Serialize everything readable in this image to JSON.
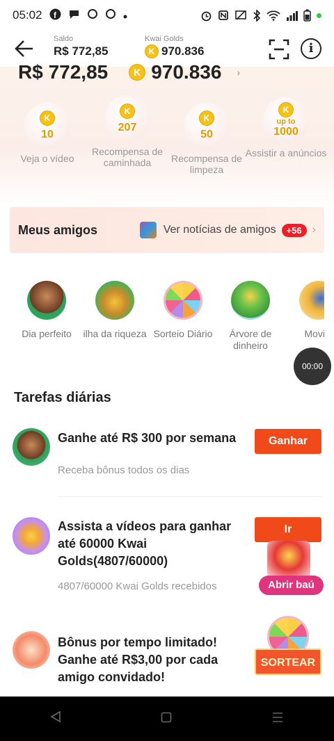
{
  "status": {
    "time": "05:02",
    "icons": [
      "facebook-icon",
      "chat-icon",
      "app-icon",
      "app-icon",
      "dot-icon"
    ],
    "right_icons": [
      "alarm-icon",
      "nfc-icon",
      "cast-icon",
      "bluetooth-icon",
      "wifi-icon",
      "signal-icon",
      "battery-icon"
    ]
  },
  "header": {
    "saldo_label": "Saldo",
    "saldo_value": "R$ 772,85",
    "golds_label": "Kwai Golds",
    "golds_value": "970.836"
  },
  "balance": {
    "money": "R$ 772,85",
    "golds": "970.836",
    "coin_letter": "K",
    "chevron": "›"
  },
  "rewards": [
    {
      "value": "10",
      "label": "Veja o vídeo"
    },
    {
      "value": "207",
      "label": "Recompensa de caminhada"
    },
    {
      "value": "50",
      "label": "Recompensa de limpeza"
    },
    {
      "prefix": "up to",
      "value": "1000",
      "label": "Assistir a anúncios"
    }
  ],
  "friends": {
    "title": "Meus amigos",
    "news": "Ver notícias de amigos",
    "badge": "+56"
  },
  "games": [
    {
      "label": "Dia perfeito"
    },
    {
      "label": "ilha da riqueza"
    },
    {
      "label": "Sorteio Diário"
    },
    {
      "label": "Árvore de dinheiro"
    },
    {
      "label": "Movim"
    }
  ],
  "timer": "00:00",
  "tasks": {
    "title": "Tarefas diárias",
    "items": [
      {
        "title": "Ganhe até R$ 300 por semana",
        "subtitle": "Receba bônus todos os dias",
        "button": "Ganhar"
      },
      {
        "title": "Assista a vídeos para ganhar até 60000 Kwai Golds(4807/60000)",
        "subtitle": "4807/60000 Kwai Golds recebidos",
        "button": "Ir",
        "chest_label": "Abrir baú"
      },
      {
        "title": "Bônus por tempo limitado! Ganhe até R$3,00 por cada amigo convidado!",
        "button": "SORTEAR"
      }
    ]
  },
  "colors": {
    "accent": "#f04a1b",
    "gold": "#f6c21a",
    "badge": "#e8202a"
  }
}
